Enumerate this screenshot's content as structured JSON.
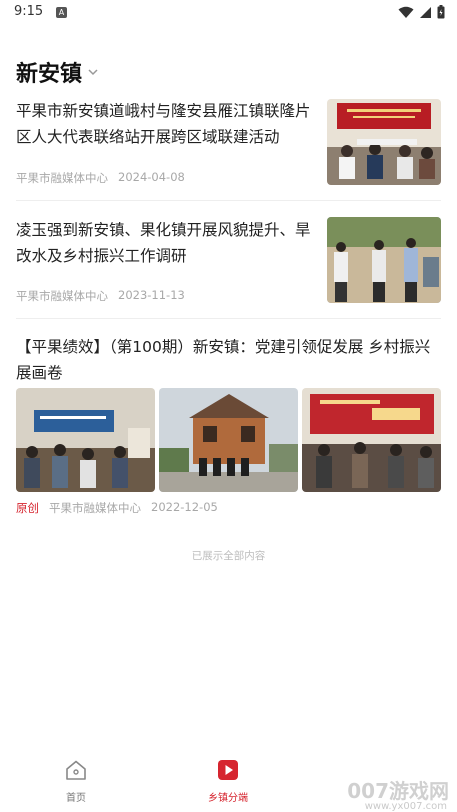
{
  "status_bar": {
    "time": "9:15",
    "indicator_icon": "a-badge-icon",
    "signal_icon": "wifi-icon",
    "cell_icon": "cell-signal-icon",
    "battery_icon": "battery-icon"
  },
  "header": {
    "title": "新安镇",
    "dropdown_icon": "chevron-down-icon"
  },
  "news": [
    {
      "title": "平果市新安镇道峨村与隆安县雁江镇联隆片区人大代表联络站开展跨区域联建活动",
      "source": "平果市融媒体中心",
      "date": "2024-04-08"
    },
    {
      "title": "凌玉强到新安镇、果化镇开展风貌提升、旱改水及乡村振兴工作调研",
      "source": "平果市融媒体中心",
      "date": "2023-11-13"
    },
    {
      "title": "【平果绩效】（第100期）新安镇：党建引领促发展  乡村振兴展画卷",
      "tag": "原创",
      "source": "平果市融媒体中心",
      "date": "2022-12-05"
    }
  ],
  "end_text": "已展示全部内容",
  "bottom_nav": [
    {
      "label": "首页",
      "icon": "home-icon"
    },
    {
      "label": "乡镇分端",
      "icon": "play-tab-icon"
    }
  ],
  "colors": {
    "accent": "#d6252f",
    "meta": "#a8a8a8"
  },
  "watermark": {
    "text": "007游戏网",
    "url": "www.yx007.com"
  }
}
